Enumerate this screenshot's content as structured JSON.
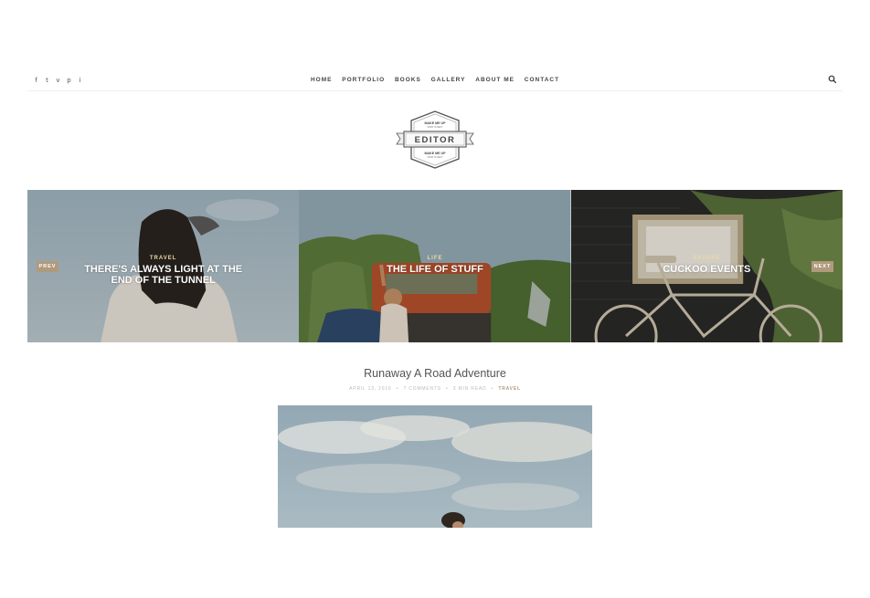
{
  "social": {
    "icons": [
      "facebook-icon",
      "twitter-icon",
      "vine-icon",
      "pinterest-icon",
      "instagram-icon"
    ],
    "glyphs": [
      "f",
      "t",
      "v",
      "p",
      "i"
    ]
  },
  "nav": {
    "items": [
      "HOME",
      "PORTFOLIO",
      "BOOKS",
      "GALLERY",
      "ABOUT ME",
      "CONTACT"
    ]
  },
  "logo": {
    "top_text": "MAKE ME UP",
    "top_sub": "WHAT IS NEXT",
    "name": "EDITOR",
    "bottom_text": "MAKE ME UP",
    "bottom_sub": "WHAT IS NEXT"
  },
  "slider": {
    "prev_label": "PREV",
    "next_label": "NEXT",
    "slides": [
      {
        "category": "TRAVEL",
        "title": "THERE'S ALWAYS LIGHT AT THE END OF THE TUNNEL"
      },
      {
        "category": "LIFE",
        "title": "THE LIFE OF STUFF"
      },
      {
        "category": "NATURE",
        "title": "CUCKOO EVENTS"
      }
    ]
  },
  "post": {
    "title": "Runaway A Road Adventure",
    "date": "APRIL 13, 2016",
    "comments": "7 COMMENTS",
    "read_time": "3 MIN READ",
    "category": "TRAVEL",
    "separator": "•"
  },
  "colors": {
    "accent": "#b09a7e",
    "category_text": "#e9d9a6"
  }
}
